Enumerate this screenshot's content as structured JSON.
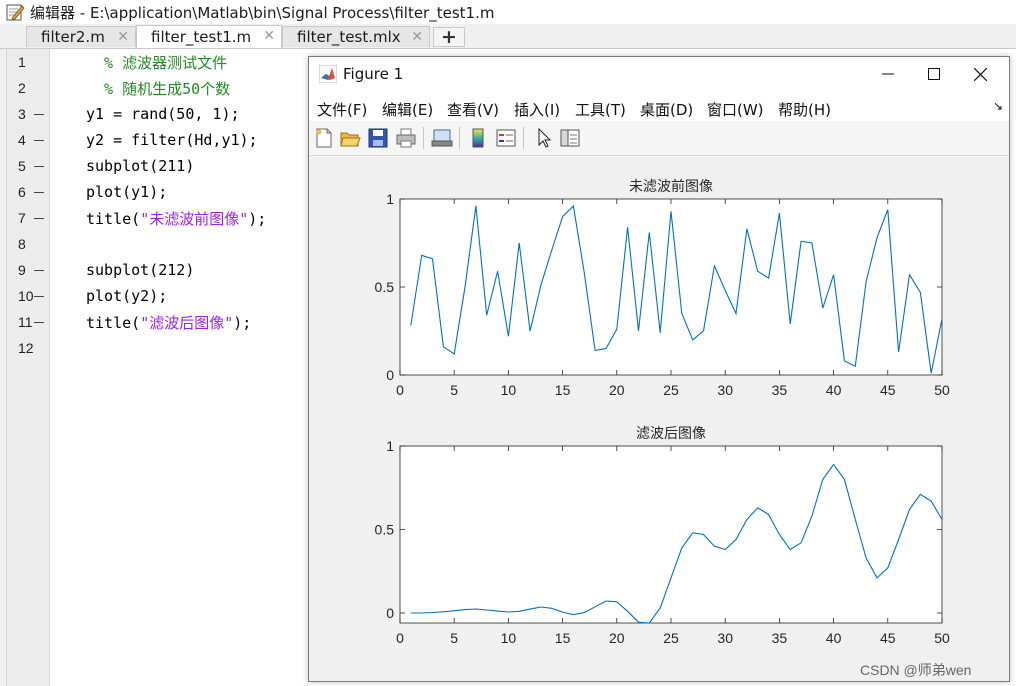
{
  "editor": {
    "title": "编辑器 - E:\\application\\Matlab\\bin\\Signal Process\\filter_test1.m",
    "tabs": [
      {
        "label": "filter2.m",
        "close": "✕"
      },
      {
        "label": "filter_test1.m",
        "close": "✕"
      },
      {
        "label": "filter_test.mlx",
        "close": "✕"
      }
    ],
    "add_tab": "+",
    "lines": [
      {
        "num": "1",
        "breakpoint": false,
        "segments": [
          {
            "t": "  % 滤波器测试文件",
            "c": "comment"
          }
        ]
      },
      {
        "num": "2",
        "breakpoint": false,
        "segments": [
          {
            "t": "  % 随机生成50个数",
            "c": "comment"
          }
        ]
      },
      {
        "num": "3",
        "breakpoint": true,
        "segments": [
          {
            "t": "y1 = rand(50, 1);",
            "c": "code"
          }
        ]
      },
      {
        "num": "4",
        "breakpoint": true,
        "segments": [
          {
            "t": "y2 = filter(Hd,y1);",
            "c": "code"
          }
        ]
      },
      {
        "num": "5",
        "breakpoint": true,
        "segments": [
          {
            "t": "subplot(211)",
            "c": "code"
          }
        ]
      },
      {
        "num": "6",
        "breakpoint": true,
        "segments": [
          {
            "t": "plot(y1);",
            "c": "code"
          }
        ]
      },
      {
        "num": "7",
        "breakpoint": true,
        "segments": [
          {
            "t": "title(",
            "c": "code"
          },
          {
            "t": "\"未滤波前图像\"",
            "c": "string"
          },
          {
            "t": ");",
            "c": "code"
          }
        ]
      },
      {
        "num": "8",
        "breakpoint": false,
        "segments": []
      },
      {
        "num": "9",
        "breakpoint": true,
        "segments": [
          {
            "t": "subplot(212)",
            "c": "code"
          }
        ]
      },
      {
        "num": "10",
        "breakpoint": true,
        "segments": [
          {
            "t": "plot(y2);",
            "c": "code"
          }
        ]
      },
      {
        "num": "11",
        "breakpoint": true,
        "segments": [
          {
            "t": "title(",
            "c": "code"
          },
          {
            "t": "\"滤波后图像\"",
            "c": "string"
          },
          {
            "t": ");",
            "c": "code"
          }
        ]
      },
      {
        "num": "12",
        "breakpoint": false,
        "segments": []
      }
    ]
  },
  "figure": {
    "title": "Figure 1",
    "menu": [
      "文件(F)",
      "编辑(E)",
      "查看(V)",
      "插入(I)",
      "工具(T)",
      "桌面(D)",
      "窗口(W)",
      "帮助(H)"
    ],
    "menu_more": "↘",
    "toolbar": [
      "new-figure-icon",
      "open-file-icon",
      "save-icon",
      "print-icon",
      "link-plot-icon",
      "colorbar-icon",
      "legend-icon",
      "pointer-icon",
      "property-editor-icon"
    ]
  },
  "chart_data": [
    {
      "type": "line",
      "title": "未滤波前图像",
      "xlabel": "",
      "ylabel": "",
      "xlim": [
        0,
        50
      ],
      "ylim": [
        0,
        1
      ],
      "xticks": [
        0,
        5,
        10,
        15,
        20,
        25,
        30,
        35,
        40,
        45,
        50
      ],
      "yticks": [
        0,
        0.5,
        1
      ],
      "grid": false,
      "color": "#0072BD",
      "x": [
        1,
        2,
        3,
        4,
        5,
        6,
        7,
        8,
        9,
        10,
        11,
        12,
        13,
        14,
        15,
        16,
        17,
        18,
        19,
        20,
        21,
        22,
        23,
        24,
        25,
        26,
        27,
        28,
        29,
        30,
        31,
        32,
        33,
        34,
        35,
        36,
        37,
        38,
        39,
        40,
        41,
        42,
        43,
        44,
        45,
        46,
        47,
        48,
        49,
        50
      ],
      "y": [
        0.28,
        0.68,
        0.66,
        0.16,
        0.12,
        0.5,
        0.96,
        0.34,
        0.59,
        0.22,
        0.75,
        0.25,
        0.51,
        0.71,
        0.9,
        0.96,
        0.58,
        0.14,
        0.15,
        0.26,
        0.84,
        0.25,
        0.81,
        0.24,
        0.93,
        0.35,
        0.2,
        0.25,
        0.62,
        0.48,
        0.35,
        0.83,
        0.59,
        0.55,
        0.92,
        0.29,
        0.76,
        0.75,
        0.38,
        0.57,
        0.08,
        0.05,
        0.53,
        0.78,
        0.94,
        0.13,
        0.57,
        0.47,
        0.01,
        0.32
      ]
    },
    {
      "type": "line",
      "title": "滤波后图像",
      "xlabel": "",
      "ylabel": "",
      "xlim": [
        0,
        50
      ],
      "ylim": [
        -0.06,
        1
      ],
      "xticks": [
        0,
        5,
        10,
        15,
        20,
        25,
        30,
        35,
        40,
        45,
        50
      ],
      "yticks": [
        0,
        0.5,
        1
      ],
      "grid": false,
      "color": "#0072BD",
      "x": [
        1,
        2,
        3,
        4,
        5,
        6,
        7,
        8,
        9,
        10,
        11,
        12,
        13,
        14,
        15,
        16,
        17,
        18,
        19,
        20,
        21,
        22,
        23,
        24,
        25,
        26,
        27,
        28,
        29,
        30,
        31,
        32,
        33,
        34,
        35,
        36,
        37,
        38,
        39,
        40,
        41,
        42,
        43,
        44,
        45,
        46,
        47,
        48,
        49,
        50
      ],
      "y": [
        0.0,
        0.0,
        0.003,
        0.007,
        0.013,
        0.02,
        0.024,
        0.018,
        0.011,
        0.006,
        0.01,
        0.023,
        0.036,
        0.028,
        0.005,
        -0.01,
        0.002,
        0.037,
        0.072,
        0.067,
        0.01,
        -0.055,
        -0.06,
        0.03,
        0.21,
        0.39,
        0.48,
        0.47,
        0.4,
        0.38,
        0.44,
        0.56,
        0.63,
        0.59,
        0.47,
        0.38,
        0.42,
        0.58,
        0.8,
        0.89,
        0.8,
        0.56,
        0.33,
        0.21,
        0.27,
        0.44,
        0.62,
        0.71,
        0.67,
        0.56
      ]
    }
  ],
  "watermark": "CSDN @师弟wen"
}
